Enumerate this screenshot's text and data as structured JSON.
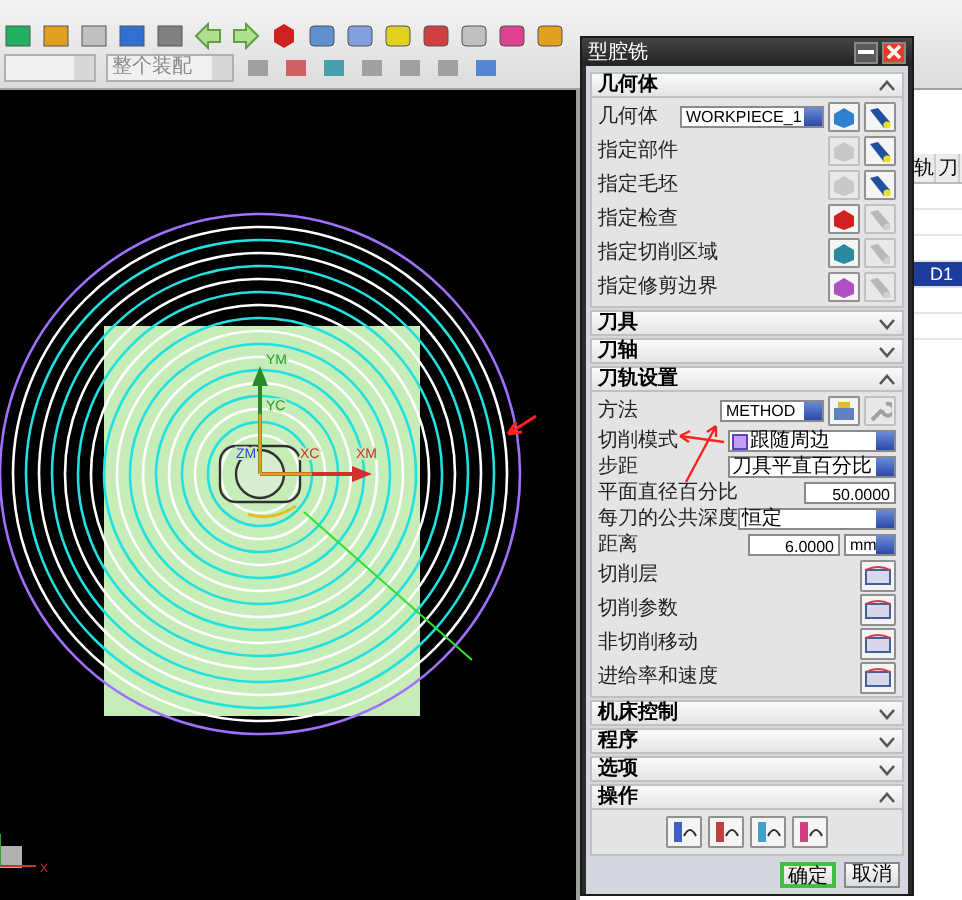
{
  "toolbar": {
    "layer_filter": "整个装配"
  },
  "viewport": {
    "axis_labels": [
      {
        "kind": "ym",
        "text": "YM"
      },
      {
        "kind": "yc",
        "text": "YC"
      },
      {
        "kind": "zm",
        "text": "ZM"
      },
      {
        "kind": "xc",
        "text": "XC"
      },
      {
        "kind": "xm",
        "text": "XM"
      }
    ],
    "triad_label": "X"
  },
  "side_table": {
    "columns": [
      "轨",
      "刀"
    ],
    "rows": [
      {
        "cell": "D1",
        "selected": true
      }
    ]
  },
  "dialog": {
    "title": "型腔铣",
    "sections": [
      {
        "kind": "geometry",
        "title": "几何体",
        "expanded": true,
        "rows": [
          {
            "label": "几何体",
            "value": "WORKPIECE_1",
            "select_enabled": true,
            "display_enabled": true
          },
          {
            "label": "指定部件",
            "select_enabled": false,
            "display_enabled": true
          },
          {
            "label": "指定毛坯",
            "select_enabled": false,
            "display_enabled": true
          },
          {
            "label": "指定检查",
            "select_enabled": true,
            "display_enabled": false
          },
          {
            "label": "指定切削区域",
            "select_enabled": true,
            "display_enabled": false
          },
          {
            "label": "指定修剪边界",
            "select_enabled": true,
            "display_enabled": false
          }
        ]
      },
      {
        "title": "刀具",
        "expanded": false
      },
      {
        "title": "刀轴",
        "expanded": false
      },
      {
        "kind": "path_settings",
        "title": "刀轨设置",
        "expanded": true,
        "rows": [
          {
            "kind": "method",
            "label": "方法",
            "value": "METHOD"
          },
          {
            "kind": "dropdown_icon",
            "label": "切削模式",
            "value": "跟随周边"
          },
          {
            "kind": "dropdown",
            "label": "步距",
            "value": "刀具平直百分比"
          },
          {
            "kind": "number",
            "label": "平面直径百分比",
            "value": "50.0000"
          },
          {
            "kind": "dropdown",
            "label": "每刀的公共深度",
            "value": "恒定"
          },
          {
            "kind": "number_unit",
            "label": "距离",
            "value": "6.0000",
            "unit": "mm"
          },
          {
            "kind": "icon_button",
            "label": "切削层"
          },
          {
            "kind": "icon_button",
            "label": "切削参数"
          },
          {
            "kind": "icon_button",
            "label": "非切削移动"
          },
          {
            "kind": "icon_button",
            "label": "进给率和速度"
          }
        ]
      },
      {
        "title": "机床控制",
        "expanded": false
      },
      {
        "title": "程序",
        "expanded": false
      },
      {
        "title": "选项",
        "expanded": false
      },
      {
        "kind": "operations",
        "title": "操作",
        "expanded": true
      }
    ],
    "buttons": [
      {
        "label": "确定",
        "default": true
      },
      {
        "label": "取消",
        "default": false
      }
    ]
  }
}
